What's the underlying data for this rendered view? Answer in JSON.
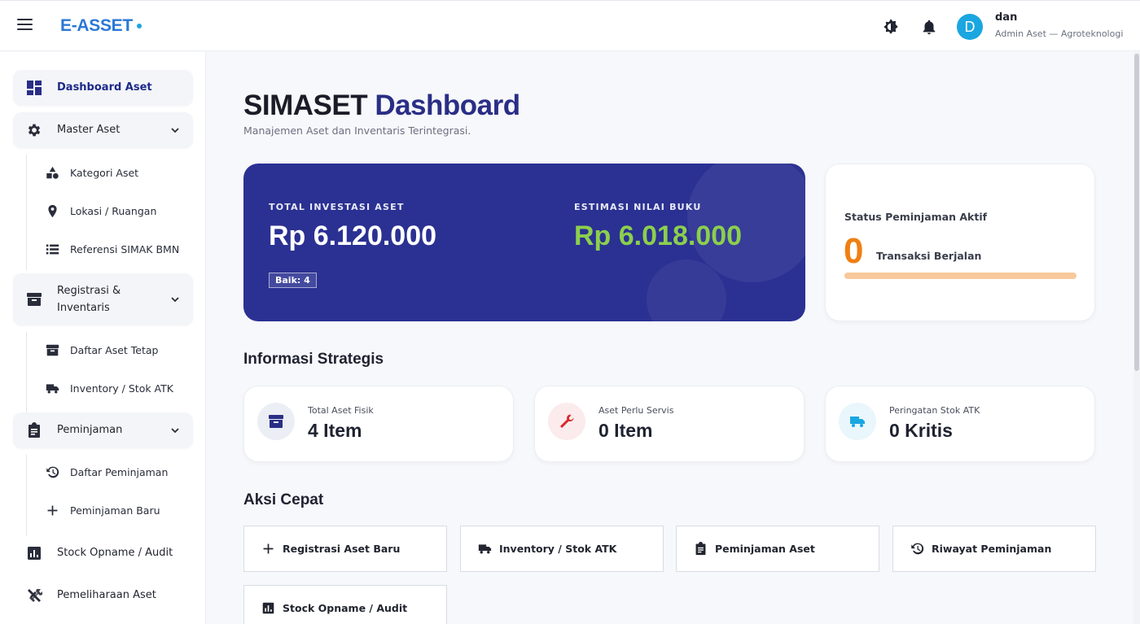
{
  "header": {
    "brand": "E-ASSET",
    "user_initial": "D",
    "user_name": "dan",
    "user_role": "Admin Aset — Agroteknologi"
  },
  "sidebar": {
    "dashboard": "Dashboard Aset",
    "master_aset": "Master Aset",
    "master_items": [
      "Kategori Aset",
      "Lokasi / Ruangan",
      "Referensi SIMAK BMN"
    ],
    "registrasi": "Registrasi & Inventaris",
    "registrasi_items": [
      "Daftar Aset Tetap",
      "Inventory / Stok ATK"
    ],
    "peminjaman": "Peminjaman",
    "peminjaman_items": [
      "Daftar Peminjaman",
      "Peminjaman Baru"
    ],
    "stock_opname": "Stock Opname / Audit",
    "pemeliharaan": "Pemeliharaan Aset"
  },
  "main": {
    "title_part1": "SIMASET",
    "title_part2": "Dashboard",
    "subtitle": "Manajemen Aset dan Inventaris Terintegrasi."
  },
  "hero": {
    "total_label": "TOTAL INVESTASI ASET",
    "total_value": "Rp 6.120.000",
    "book_label": "ESTIMASI NILAI BUKU",
    "book_value": "Rp 6.018.000",
    "badge": "Baik: 4"
  },
  "loan_status": {
    "title": "Status Peminjaman Aktif",
    "count": "0",
    "subtitle": "Transaksi Berjalan"
  },
  "info_section_title": "Informasi Strategis",
  "info_cards": [
    {
      "label": "Total Aset Fisik",
      "value": "4 Item"
    },
    {
      "label": "Aset Perlu Servis",
      "value": "0 Item"
    },
    {
      "label": "Peringatan Stok ATK",
      "value": "0 Kritis"
    }
  ],
  "quick_section_title": "Aksi Cepat",
  "quick_actions": [
    {
      "label": "Registrasi Aset Baru"
    },
    {
      "label": "Inventory / Stok ATK"
    },
    {
      "label": "Peminjaman Aset"
    },
    {
      "label": "Riwayat Peminjaman"
    },
    {
      "label": "Stock Opname / Audit"
    }
  ],
  "colors": {
    "primary": "#2b3192",
    "accent_green": "#8ccf4d",
    "accent_orange": "#f07f13",
    "brand_blue": "#2b78d6"
  }
}
